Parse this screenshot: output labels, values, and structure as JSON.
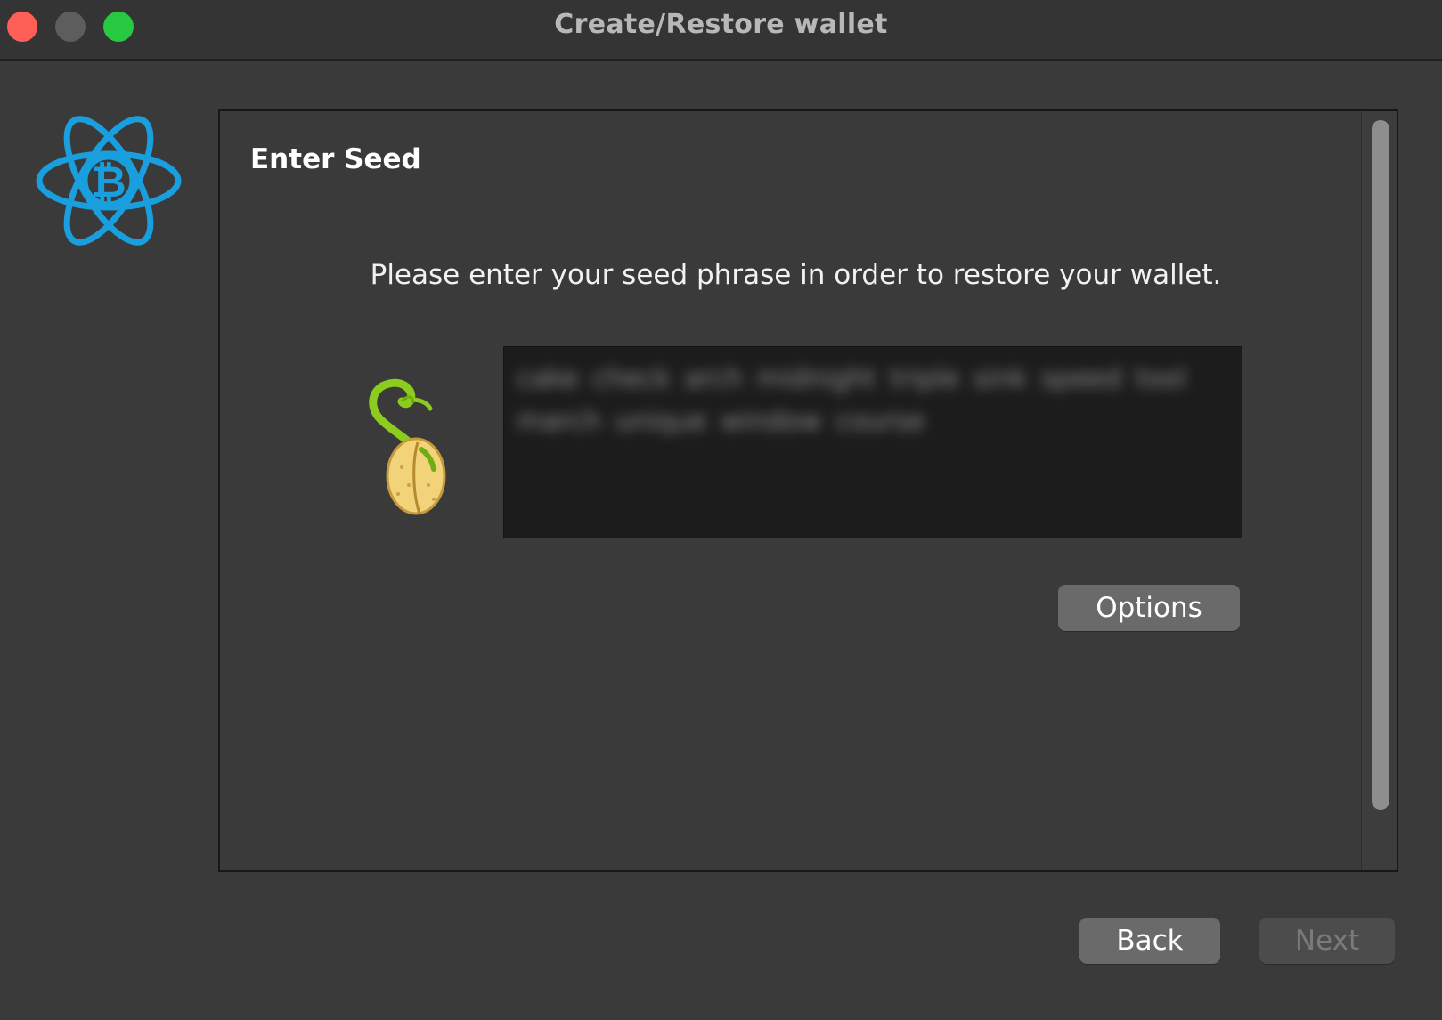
{
  "window": {
    "title": "Create/Restore wallet"
  },
  "panel": {
    "title": "Enter Seed",
    "instruction": "Please enter your seed phrase in order to restore your wallet.",
    "seed_text_obscured": "cake check arch midnight triple sink speed tool march unique window course",
    "options_label": "Options"
  },
  "footer": {
    "back_label": "Back",
    "next_label": "Next",
    "next_enabled": false
  },
  "icons": {
    "logo": "electrum-bitcoin-logo-icon",
    "seed": "sprouting-seed-icon"
  },
  "colors": {
    "logo_blue": "#1a9fde",
    "close": "#fe5f57",
    "minimize": "#5d5d5d",
    "zoom": "#28c840",
    "window_bg": "#3a3a3a",
    "seed_box_bg": "#1c1c1c",
    "button_bg": "#6a6a6a"
  }
}
